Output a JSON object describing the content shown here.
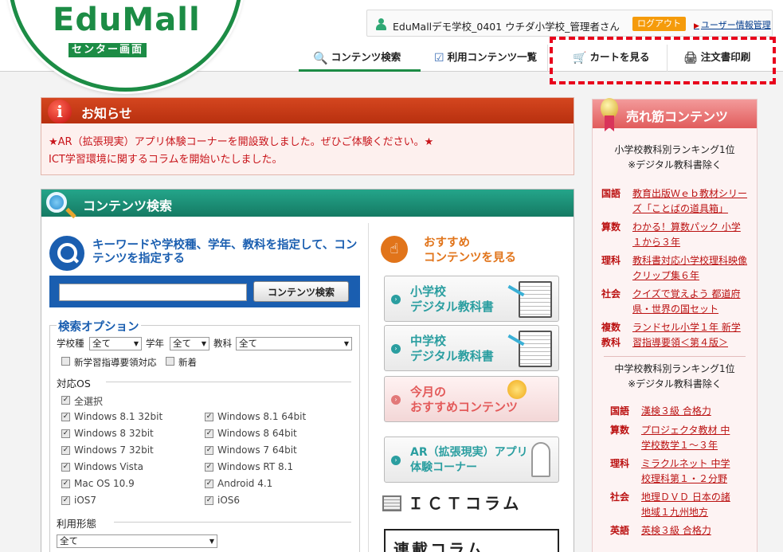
{
  "header": {
    "logo_text": "EduMall",
    "logo_sub": "センター画面",
    "user_name": "EduMallデモ学校_0401 ウチダ小学校_管理者さん",
    "logout": "ログアウト",
    "user_info": "ユーザー情報管理"
  },
  "nav": {
    "search": "コンテンツ検索",
    "usage": "利用コンテンツ一覧",
    "cart": "カートを見る",
    "print": "注文書印刷"
  },
  "notice": {
    "title": "お知らせ",
    "line1": "★AR（拡張現実）アプリ体験コーナーを開設致しました。ぜひご体験ください。★",
    "line2": "ICT学習環境に関するコラムを開始いたしました。"
  },
  "search": {
    "title": "コンテンツ検索",
    "keyword_heading": "キーワードや学校種、学年、教科を指定して、コンテンツを指定する",
    "input_value": "",
    "button": "コンテンツ検索",
    "options_heading": "検索オプション",
    "school_type_label": "学校種",
    "school_type_value": "全て",
    "grade_label": "学年",
    "grade_value": "全て",
    "subject_label": "教科",
    "subject_value": "全て",
    "new_guideline": "新学習指導要領対応",
    "new_arrival": "新着",
    "os_heading": "対応OS",
    "select_all": "全選択",
    "os": [
      {
        "left": "Windows 8.1 32bit",
        "right": "Windows 8.1 64bit"
      },
      {
        "left": "Windows 8 32bit",
        "right": "Windows 8 64bit"
      },
      {
        "left": "Windows 7 32bit",
        "right": "Windows 7 64bit"
      },
      {
        "left": "Windows Vista",
        "right": "Windows RT 8.1"
      },
      {
        "left": "Mac OS 10.9",
        "right": "Android 4.1"
      },
      {
        "left": "iOS7",
        "right": "iOS6"
      }
    ],
    "usage_heading": "利用形態",
    "usage_value": "全て"
  },
  "recommend": {
    "title_line1": "おすすめ",
    "title_line2": "コンテンツを見る",
    "cards": [
      {
        "line1": "小学校",
        "line2": "デジタル教科書"
      },
      {
        "line1": "中学校",
        "line2": "デジタル教科書"
      },
      {
        "line1": "今月の",
        "line2": "おすすめコンテンツ"
      },
      {
        "line1": "AR（拡張現実）アプリ",
        "line2": "体験コーナー"
      }
    ],
    "ict_title": "ＩＣＴコラム",
    "column_title": "連載コラム"
  },
  "ranking": {
    "title": "売れ筋コンテンツ",
    "elem_caption_1": "小学校教科別ランキング1位",
    "elem_caption_2": "※デジタル教科書除く",
    "elem_items": [
      {
        "subject": "国語",
        "title_1": "教育出版Ｗｅｂ教材シリー",
        "title_2": "ズ「ことばの道具箱」"
      },
      {
        "subject": "算数",
        "title_1": "わかる！算数パック 小学",
        "title_2": "１から３年"
      },
      {
        "subject": "理科",
        "title_1": "教科書対応小学校理科映像",
        "title_2": "クリップ集６年"
      },
      {
        "subject": "社会",
        "title_1": "クイズで覚えよう 都道府",
        "title_2": "県・世界の国セット"
      },
      {
        "subject": "複数",
        "subject_2": "教科",
        "title_1": "ランドセル小学１年 新学",
        "title_2": "習指導要領＜第４版＞"
      }
    ],
    "jh_caption_1": "中学校教科別ランキング1位",
    "jh_caption_2": "※デジタル教科書除く",
    "jh_items": [
      {
        "subject": "国語",
        "title_1": "漢検３級 合格力",
        "title_2": ""
      },
      {
        "subject": "算数",
        "title_1": "プロジェクタ教材 中",
        "title_2": "学校数学１～３年"
      },
      {
        "subject": "理科",
        "title_1": "ミラクルネット 中学",
        "title_2": "校理科第１・２分野"
      },
      {
        "subject": "社会",
        "title_1": "地理ＤＶＤ 日本の諸",
        "title_2": "地域１九州地方"
      },
      {
        "subject": "英語",
        "title_1": "英検３級 合格力",
        "title_2": ""
      }
    ]
  }
}
